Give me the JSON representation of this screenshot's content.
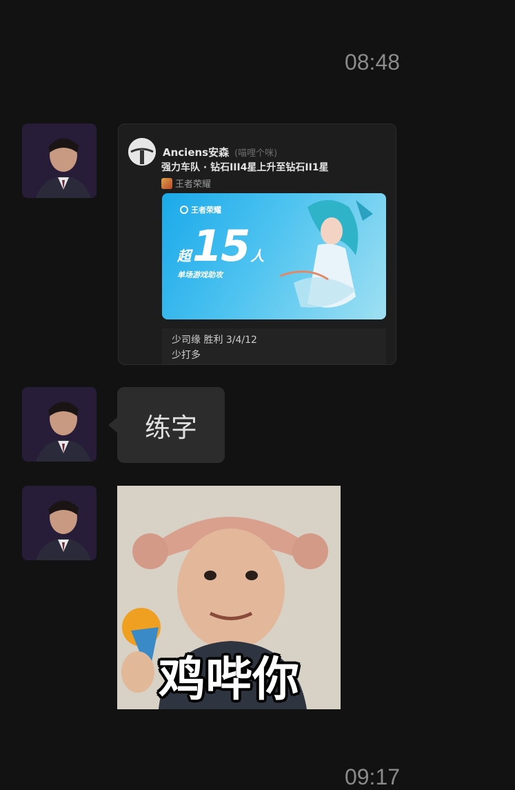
{
  "messages": {
    "timestamp_top": "08:48",
    "timestamp_bottom": "09:17",
    "shared_card": {
      "author_name": "Anciens安森",
      "author_nickname": "(喵哩个咪)",
      "title": "强力车队 · 钻石III4星上升至钻石II1星",
      "game_name": "王者荣耀",
      "banner": {
        "logo_text": "王者荣耀",
        "prefix": "超",
        "number": "15",
        "suffix": "人",
        "subtitle": "单场游戏助攻"
      },
      "stats_line1": "少司缘 胜利 3/4/12",
      "stats_line2": "少打多"
    },
    "text_bubble": "练字",
    "sticker_caption": "鸡哔你"
  }
}
